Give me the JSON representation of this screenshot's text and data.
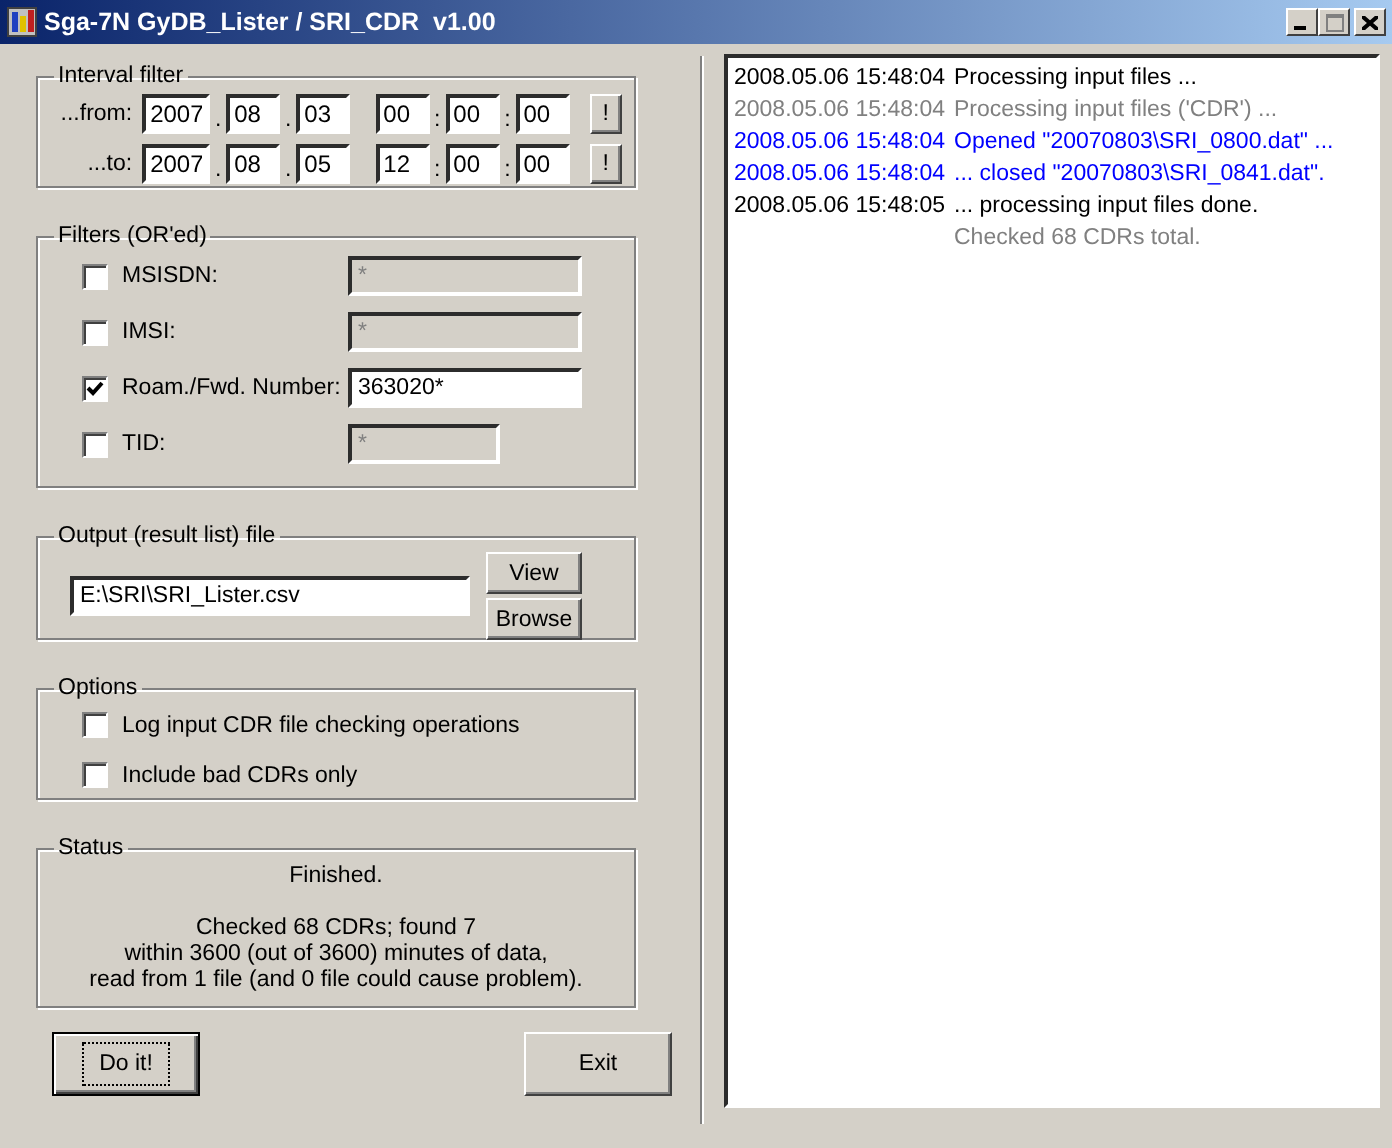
{
  "window": {
    "title": "Sga-7N GyDB_Lister / SRI_CDR  v1.00"
  },
  "interval_filter": {
    "title": "Interval filter",
    "rows": [
      {
        "label": "...from:",
        "fields": [
          {
            "value": "2007"
          },
          {
            "sep": ".",
            "value": "08"
          },
          {
            "sep": ".",
            "value": "03"
          },
          {
            "value": "00"
          },
          {
            "sep": ":",
            "value": "00"
          },
          {
            "sep": ":",
            "value": "00"
          }
        ],
        "button": "!"
      },
      {
        "label": "...to:",
        "fields": [
          {
            "value": "2007"
          },
          {
            "sep": ".",
            "value": "08"
          },
          {
            "sep": ".",
            "value": "05"
          },
          {
            "value": "12"
          },
          {
            "sep": ":",
            "value": "00"
          },
          {
            "sep": ":",
            "value": "00"
          }
        ],
        "button": "!"
      }
    ]
  },
  "filters": {
    "title": "Filters  (OR'ed)",
    "items": [
      {
        "label": "MSISDN:",
        "checked": false,
        "value": "*",
        "disabled": true
      },
      {
        "label": "IMSI:",
        "checked": false,
        "value": "*",
        "disabled": true
      },
      {
        "label": "Roam./Fwd. Number:",
        "checked": true,
        "value": "363020*",
        "disabled": false
      },
      {
        "label": "TID:",
        "checked": false,
        "value": "*",
        "disabled": true
      }
    ]
  },
  "output": {
    "title": "Output (result list) file",
    "value": "E:\\SRI\\SRI_Lister.csv",
    "buttons": [
      "View",
      "Browse"
    ]
  },
  "options": {
    "title": "Options",
    "items": [
      {
        "label": "Log input CDR file checking operations",
        "checked": false
      },
      {
        "label": "Include bad CDRs only",
        "checked": false
      }
    ]
  },
  "status": {
    "title": "Status",
    "lines": [
      "Finished.",
      "Checked 68 CDRs; found 7",
      "within 3600 (out of 3600) minutes of data,",
      "read from 1 file (and 0 file could cause problem)."
    ]
  },
  "buttons": [
    {
      "label": "Do it!",
      "kind": "default"
    },
    {
      "label": "Exit",
      "kind": "normal"
    }
  ],
  "log": [
    {
      "time": "2008.05.06 15:48:04",
      "message": "Processing input files ...",
      "kind": "normal"
    },
    {
      "time": "2008.05.06 15:48:04",
      "message": "Processing input files ('CDR') ...",
      "kind": "detail"
    },
    {
      "time": "2008.05.06 15:48:04",
      "message": "Opened \"20070803\\SRI_0800.dat\" ...",
      "kind": "file"
    },
    {
      "time": "2008.05.06 15:48:04",
      "message": "... closed \"20070803\\SRI_0841.dat\".",
      "kind": "file"
    },
    {
      "time": "2008.05.06 15:48:05",
      "message": "... processing input files done.",
      "kind": "normal"
    },
    {
      "message": "Checked 68 CDRs total.",
      "kind": "detail"
    }
  ]
}
